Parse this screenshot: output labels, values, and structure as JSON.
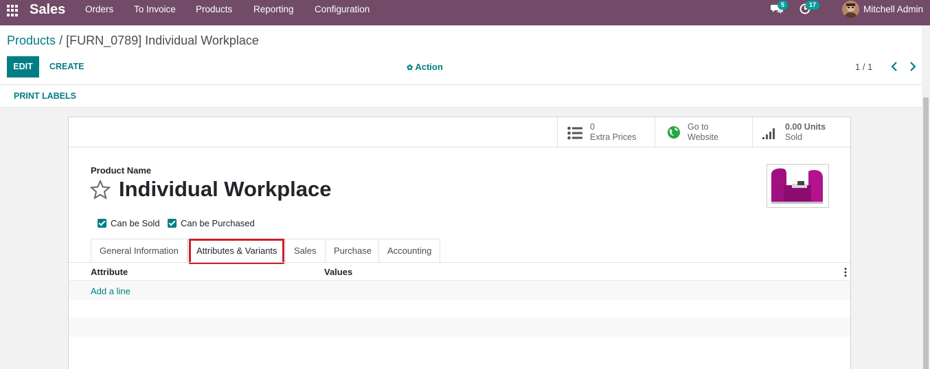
{
  "navbar": {
    "app_name": "Sales",
    "menu": [
      "Orders",
      "To Invoice",
      "Products",
      "Reporting",
      "Configuration"
    ],
    "messages_count": "5",
    "activities_count": "17",
    "user_name": "Mitchell Admin",
    "bg_color": "#714b67"
  },
  "control_panel": {
    "breadcrumb_parent": "Products",
    "breadcrumb_separator": "/",
    "breadcrumb_current": "[FURN_0789] Individual Workplace",
    "edit_label": "EDIT",
    "create_label": "CREATE",
    "action_label": "Action",
    "pager_value": "1 / 1"
  },
  "statusbar": {
    "print_labels": "PRINT LABELS"
  },
  "smart_buttons": [
    {
      "value": "0",
      "label": "Extra Prices",
      "icon": "list-icon"
    },
    {
      "value": "Go to",
      "label": "Website",
      "icon": "globe-icon"
    },
    {
      "value": "0.00 Units",
      "label": "Sold",
      "icon": "signal-icon"
    }
  ],
  "product": {
    "name_label": "Product Name",
    "name": "Individual Workplace",
    "can_be_sold_label": "Can be Sold",
    "can_be_sold": true,
    "can_be_purchased_label": "Can be Purchased",
    "can_be_purchased": true
  },
  "tabs": [
    {
      "label": "General Information",
      "active": false
    },
    {
      "label": "Attributes & Variants",
      "active": true
    },
    {
      "label": "Sales",
      "active": false
    },
    {
      "label": "Purchase",
      "active": false
    },
    {
      "label": "Accounting",
      "active": false
    }
  ],
  "attributes_table": {
    "columns": [
      "Attribute",
      "Values"
    ],
    "add_line_label": "Add a line"
  },
  "colors": {
    "primary": "#017e84",
    "brand": "#714b67",
    "highlight": "#d0202a"
  }
}
